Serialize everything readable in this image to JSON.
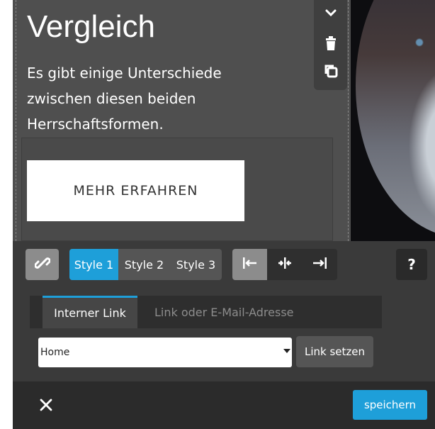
{
  "block": {
    "title": "Vergleich",
    "body": "Es gibt einige Unterschiede zwischen diesen beiden Herrschaftsformen.",
    "button_label": "MEHR ERFAHREN"
  },
  "mini_toolbar": {
    "icons": [
      "chevron-down-icon",
      "trash-icon",
      "duplicate-icon"
    ]
  },
  "button_settings": {
    "styles": [
      "Style 1",
      "Style 2",
      "Style 3"
    ],
    "active_style": "Style 1",
    "alignments": [
      "align-left-icon",
      "align-center-icon",
      "align-right-icon"
    ],
    "active_alignment": "align-left-icon",
    "help_label": "?"
  },
  "link_tabs": {
    "tabs": [
      "Interner Link",
      "Link oder E-Mail-Adresse"
    ],
    "active": "Interner Link"
  },
  "page_select": {
    "selected": "Home"
  },
  "set_link_label": "Link setzen",
  "footer": {
    "save_label": "speichern"
  },
  "colors": {
    "accent": "#1e9fd9",
    "panel": "#4f4f4f",
    "settings_bg": "#3a3a3a",
    "footer_bg": "#2b2b2b"
  }
}
